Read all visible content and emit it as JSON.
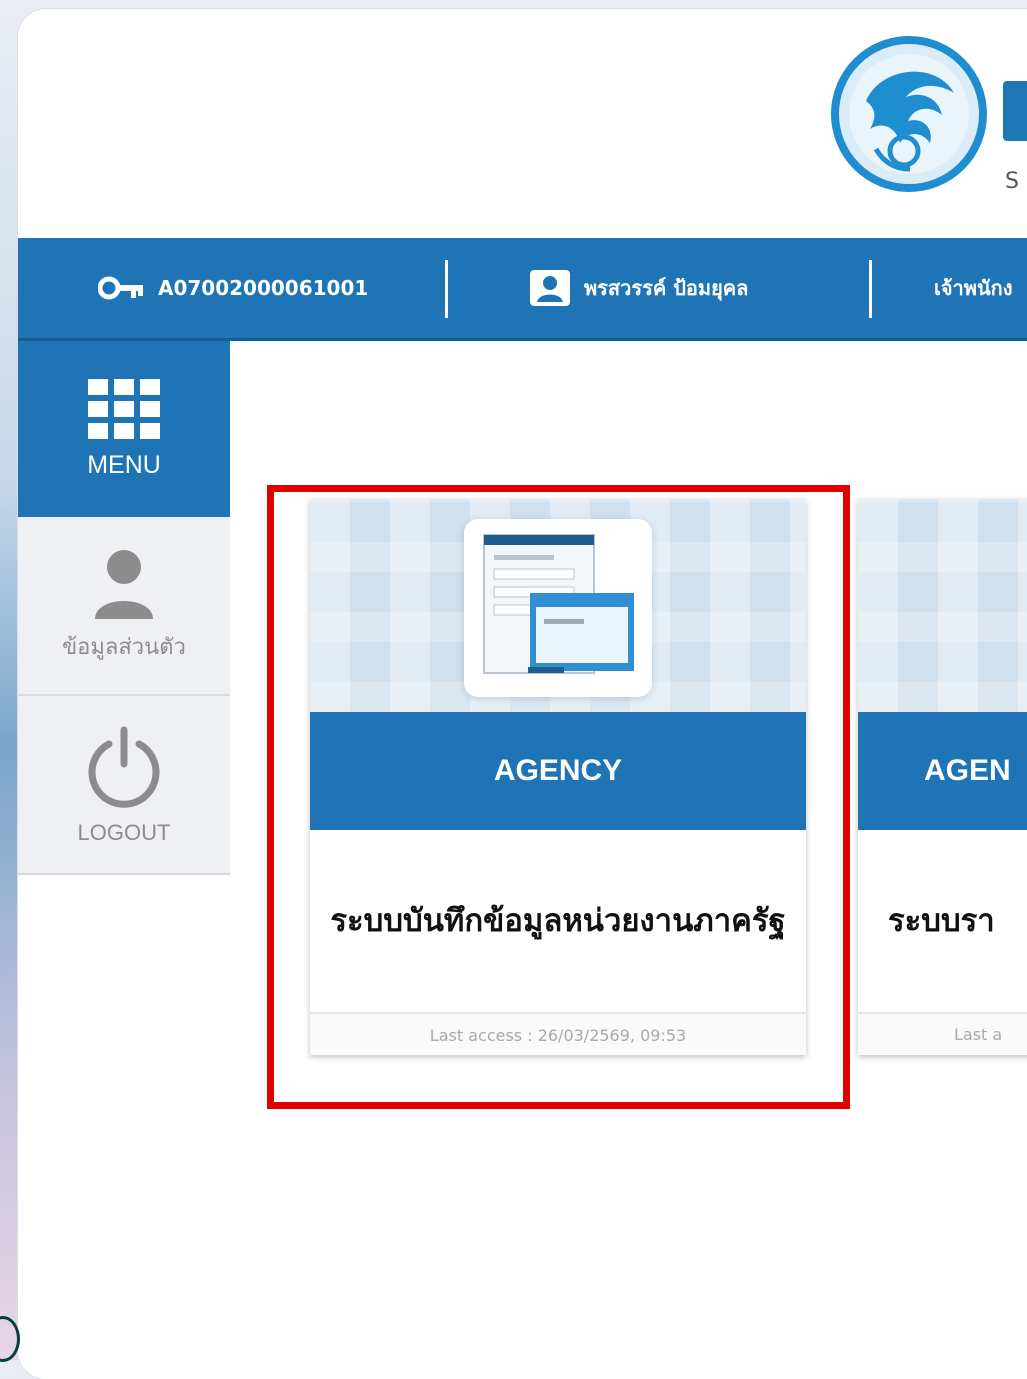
{
  "header": {
    "user_code": "A07002000061001",
    "user_name": "พรสวรรค์ ป้อมยุคล",
    "position_partial": "เจ้าพนักง",
    "logo_partial_letter": "S"
  },
  "sidebar": {
    "menu_label": "MENU",
    "profile_label": "ข้อมูลส่วนตัว",
    "logout_label": "LOGOUT"
  },
  "cards": [
    {
      "title": "AGENCY",
      "description": "ระบบบันทึกข้อมูลหน่วยงานภาครัฐ",
      "last_access": "Last access : 26/03/2569, 09:53"
    },
    {
      "title": "AGEN",
      "description": "ระบบรา",
      "last_access": "Last a"
    }
  ],
  "colors": {
    "primary_blue": "#1f74b5",
    "highlight_red": "#e00000"
  }
}
